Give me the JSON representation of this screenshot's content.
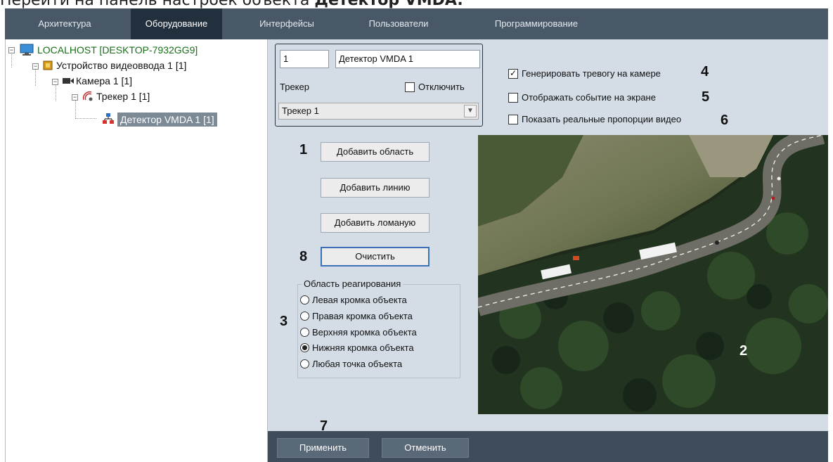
{
  "caption": {
    "prefix": "Перейти на панель настроек объекта ",
    "bold": "Детектор VMDA."
  },
  "tabs": [
    {
      "label": "Архитектура"
    },
    {
      "label": "Оборудование"
    },
    {
      "label": "Интерфейсы"
    },
    {
      "label": "Пользователи"
    },
    {
      "label": "Программирование"
    }
  ],
  "active_tab": "Оборудование",
  "tree": {
    "host": "LOCALHOST [DESKTOP-7932GG9]",
    "device": "Устройство видеоввода 1 [1]",
    "camera": "Камера 1 [1]",
    "tracker": "Трекер 1 [1]",
    "detector": "Детектор VMDA 1 [1]"
  },
  "form": {
    "id_value": "1",
    "name_value": "Детектор VMDA 1",
    "tracker_label": "Трекер",
    "disable_label": "Отключить",
    "tracker_select": "Трекер 1",
    "generate_alarm": "Генерировать тревогу на камере",
    "show_event": "Отображать событие на экране",
    "real_proportions": "Показать реальные пропорции видео",
    "add_area": "Добавить область",
    "add_line": "Добавить линию",
    "add_polyline": "Добавить ломаную",
    "clear": "Очистить",
    "response_area_title": "Область реагирования",
    "radio_options": [
      "Левая кромка объекта",
      "Правая кромка объекта",
      "Верхняя кромка объекта",
      "Нижняя кромка объекта",
      "Любая точка объекта"
    ],
    "selected_option": "Нижняя кромка объекта",
    "generate_alarm_checked": true,
    "show_event_checked": false,
    "real_proportions_checked": false,
    "disable_checked": false,
    "apply": "Применить",
    "cancel": "Отменить"
  },
  "callouts": {
    "n1": "1",
    "n2": "2",
    "n3": "3",
    "n4": "4",
    "n5": "5",
    "n6": "6",
    "n7": "7",
    "n8": "8"
  }
}
